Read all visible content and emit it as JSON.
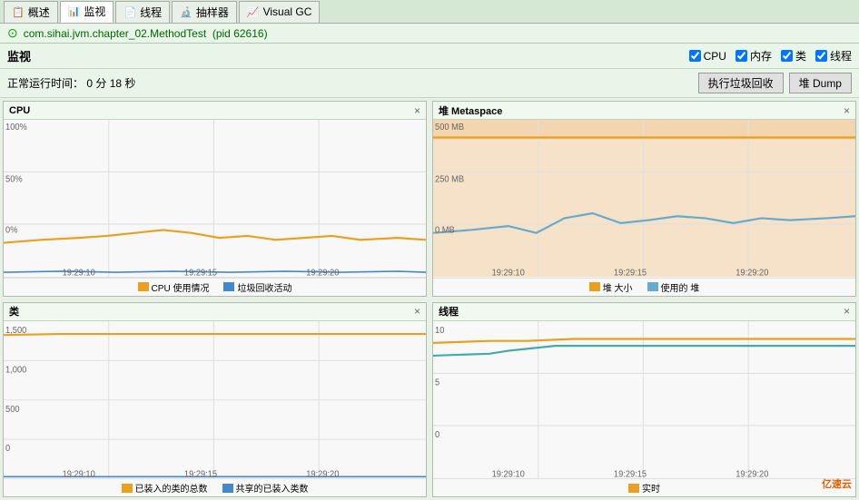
{
  "tabs": [
    {
      "id": "overview",
      "label": "概述",
      "icon": "📋",
      "active": false
    },
    {
      "id": "monitor",
      "label": "监视",
      "icon": "📊",
      "active": true
    },
    {
      "id": "threads",
      "label": "线程",
      "icon": "📄",
      "active": false
    },
    {
      "id": "sampler",
      "label": "抽样器",
      "icon": "🔬",
      "active": false
    },
    {
      "id": "visualgc",
      "label": "Visual GC",
      "icon": "📈",
      "active": false
    }
  ],
  "process": {
    "name": "com.sihai.jvm.chapter_02.MethodTest",
    "pid": "pid 62616"
  },
  "monitor": {
    "title": "监视",
    "uptime_label": "正常运行时间：",
    "uptime_value": "0 分 18 秒"
  },
  "checkboxes": [
    {
      "label": "CPU",
      "checked": true
    },
    {
      "label": "内存",
      "checked": true
    },
    {
      "label": "类",
      "checked": true
    },
    {
      "label": "线程",
      "checked": true
    }
  ],
  "buttons": {
    "gc": "执行垃圾回收",
    "dump": "堆 Dump"
  },
  "charts": {
    "cpu": {
      "title": "CPU",
      "legend": [
        {
          "label": "CPU 使用情况",
          "color": "#e8a020"
        },
        {
          "label": "垃圾回收活动",
          "color": "#4488cc"
        }
      ],
      "yLabels": [
        "100%",
        "50%",
        "0%"
      ],
      "times": [
        "19:29:10",
        "19:29:15",
        "19:29:20"
      ]
    },
    "heap": {
      "title": "堆  Metaspace",
      "legend": [
        {
          "label": "堆 大小",
          "color": "#e8a020"
        },
        {
          "label": "使用的 堆",
          "color": "#66aacc"
        }
      ],
      "yLabels": [
        "500 MB",
        "250 MB",
        "0 MB"
      ],
      "times": [
        "19:29:10",
        "19:29:15",
        "19:29:20"
      ]
    },
    "classes": {
      "title": "类",
      "legend": [
        {
          "label": "已装入的类的总数",
          "color": "#e8a020"
        },
        {
          "label": "共享的已装入类数",
          "color": "#4488cc"
        }
      ],
      "yLabels": [
        "1,500",
        "1,000",
        "500",
        "0"
      ],
      "times": [
        "19:29:10",
        "19:29:15",
        "19:29:20"
      ]
    },
    "threads": {
      "title": "线程",
      "legend": [
        {
          "label": "实时",
          "color": "#e8a020"
        }
      ],
      "yLabels": [
        "10",
        "5",
        "0"
      ],
      "times": [
        "19:29:10",
        "19:29:15",
        "19:29:20"
      ]
    }
  },
  "watermark": "亿速云"
}
